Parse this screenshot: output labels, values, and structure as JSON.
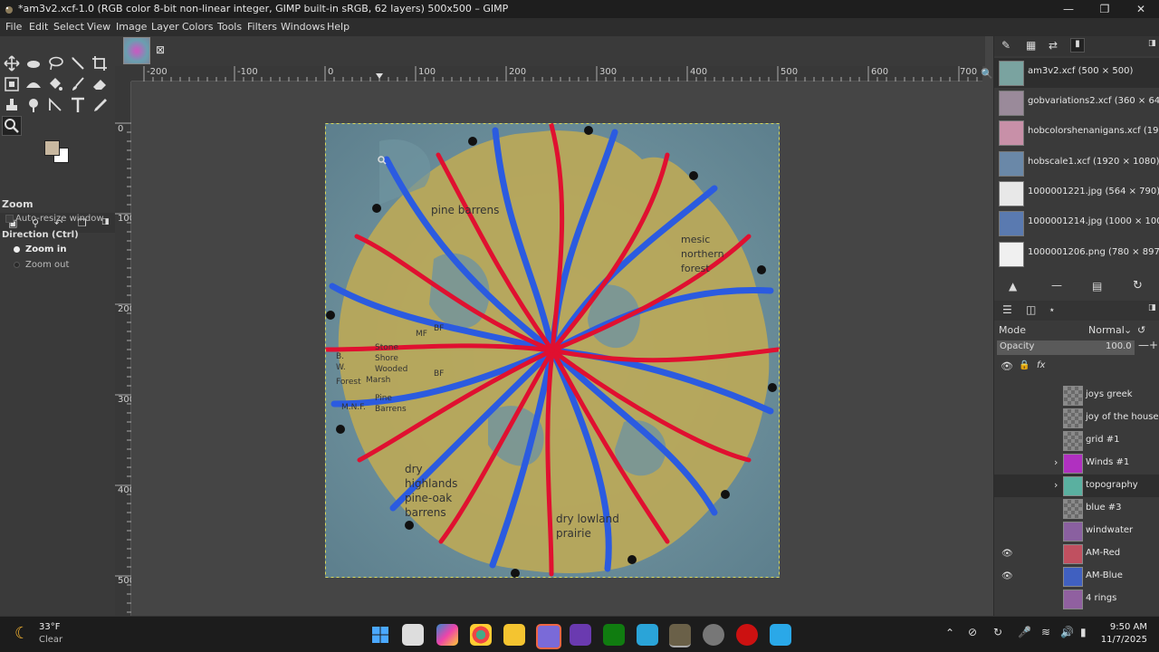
{
  "window": {
    "title": "*am3v2.xcf-1.0 (RGB color 8-bit non-linear integer, GIMP built-in sRGB, 62 layers) 500x500 – GIMP",
    "controls": [
      "minimize",
      "maximize",
      "close"
    ]
  },
  "menu": [
    "File",
    "Edit",
    "Select",
    "View",
    "Image",
    "Layer",
    "Colors",
    "Tools",
    "Filters",
    "Windows",
    "Help"
  ],
  "tool_options": {
    "tool_name": "Zoom",
    "auto_resize": "Auto-resize window",
    "direction_label": "Direction  (Ctrl)",
    "zoom_in": "Zoom in",
    "zoom_out": "Zoom out",
    "selected_direction": "Zoom in"
  },
  "colors": {
    "foreground": "#c8b8a0",
    "background": "#ffffff",
    "accent": "#2b6cb0"
  },
  "rulers": {
    "horizontal": [
      "-200",
      "-100",
      "0",
      "100",
      "200",
      "300",
      "400",
      "500",
      "600",
      "700"
    ],
    "vertical": [
      "0",
      "100",
      "200",
      "300",
      "400",
      "500"
    ]
  },
  "canvas": {
    "labels": {
      "pine_barrens": "pine barrens",
      "mesic": "mesic\nnorthern\nforest",
      "dry_highlands": "dry\nhighlands\npine-oak\nbarrens",
      "dry_lowland": "dry lowland\nprairie",
      "bf1": "BF",
      "mf": "MF",
      "stone": "Stone\nShore\nWooded\nMarsh",
      "bf2": "BF",
      "bw": "B.\nW.\nForest",
      "pine2": "Pine\nBarrens",
      "mnf": "M.N.F."
    }
  },
  "images_panel": {
    "items": [
      {
        "label": "am3v2.xcf (500 × 500)",
        "thumb": "#7aa3a0"
      },
      {
        "label": "gobvariations2.xcf (360 × 647)",
        "thumb": "#9a8a9a"
      },
      {
        "label": "hobcolorshenanigans.xcf (1920 × 1080)",
        "thumb": "#c890a8"
      },
      {
        "label": "hobscale1.xcf (1920 × 1080)",
        "thumb": "#6a88a8"
      },
      {
        "label": "1000001221.jpg (564 × 790)",
        "thumb": "#e8e8e8"
      },
      {
        "label": "1000001214.jpg (1000 × 1000)",
        "thumb": "#5a7ab0"
      },
      {
        "label": "1000001206.png (780 × 897)",
        "thumb": "#f0f0f0"
      }
    ]
  },
  "layers_panel": {
    "mode_label": "Mode",
    "mode_value": "Normal",
    "opacity_label": "Opacity",
    "opacity_value": "100.0",
    "layers": [
      {
        "name": "joys greek",
        "visible": false,
        "expandable": false,
        "tint": ""
      },
      {
        "name": "joy of the houses",
        "visible": false,
        "expandable": false,
        "tint": ""
      },
      {
        "name": "grid #1",
        "visible": false,
        "expandable": false,
        "tint": ""
      },
      {
        "name": "Winds #1",
        "visible": false,
        "expandable": true,
        "tint": "#b030c0"
      },
      {
        "name": "topography",
        "visible": false,
        "expandable": true,
        "tint": "#5ab0a0"
      },
      {
        "name": "blue #3",
        "visible": false,
        "expandable": false,
        "tint": ""
      },
      {
        "name": "windwater",
        "visible": false,
        "expandable": false,
        "tint": "#8a60a0"
      },
      {
        "name": "AM-Red",
        "visible": true,
        "expandable": false,
        "tint": "#c05060"
      },
      {
        "name": "AM-Blue",
        "visible": true,
        "expandable": false,
        "tint": "#4060c0"
      },
      {
        "name": "4 rings",
        "visible": false,
        "expandable": false,
        "tint": "#9060a0"
      }
    ]
  },
  "taskbar": {
    "weather_temp": "33°F",
    "weather_desc": "Clear",
    "time": "9:50 AM",
    "date": "11/7/2025"
  }
}
